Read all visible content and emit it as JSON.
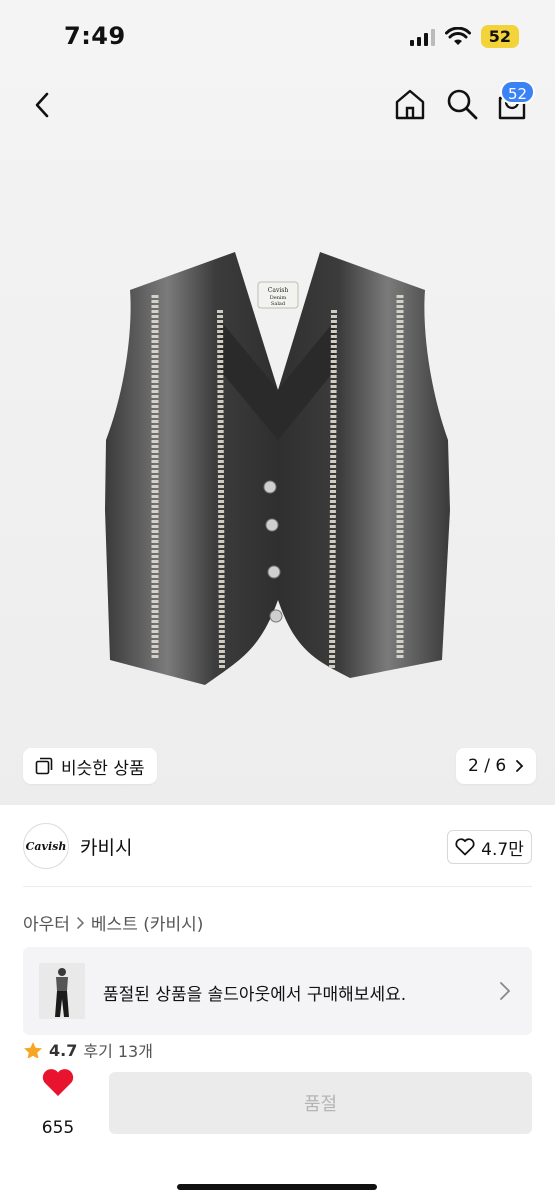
{
  "status_bar": {
    "time": "7:49",
    "battery": "52"
  },
  "nav": {
    "cart_count": "52"
  },
  "hero": {
    "similar_label": "비슷한 상품",
    "pager": "2 / 6",
    "vest_label": {
      "line1": "Cavish",
      "line2": "Denim",
      "line3": "Salad"
    }
  },
  "brand": {
    "logo_text": "Cavish",
    "name": "카비시",
    "likes": "4.7만"
  },
  "breadcrumb": {
    "category": "아우터",
    "subcategory": "베스트 (카비시)"
  },
  "banner": {
    "text": "품절된 상품을 솔드아웃에서 구매해보세요."
  },
  "rating": {
    "value": "4.7",
    "reviews": "후기 13개"
  },
  "bottom": {
    "wish_count": "655",
    "buy_label": "품절"
  },
  "colors": {
    "accent_blue": "#3b82f6",
    "heart_red": "#e8132d",
    "battery_yellow": "#f2d33a",
    "star_orange": "#f5a623"
  }
}
